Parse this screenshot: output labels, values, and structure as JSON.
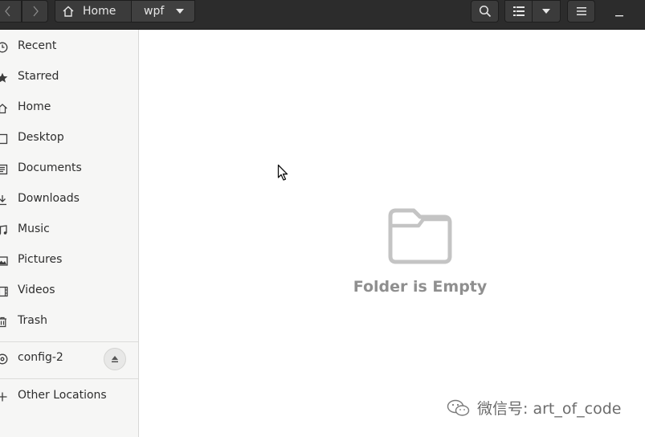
{
  "header": {
    "path": [
      {
        "label": "Home",
        "icon": "home-icon"
      },
      {
        "label": "wpf",
        "icon": "chevron-down-icon"
      }
    ]
  },
  "sidebar": {
    "places": [
      {
        "label": "Recent",
        "icon": "clock-icon"
      },
      {
        "label": "Starred",
        "icon": "star-icon"
      },
      {
        "label": "Home",
        "icon": "home-icon"
      },
      {
        "label": "Desktop",
        "icon": "desktop-icon"
      },
      {
        "label": "Documents",
        "icon": "document-icon"
      },
      {
        "label": "Downloads",
        "icon": "download-icon"
      },
      {
        "label": "Music",
        "icon": "music-icon"
      },
      {
        "label": "Pictures",
        "icon": "picture-icon"
      },
      {
        "label": "Videos",
        "icon": "video-icon"
      },
      {
        "label": "Trash",
        "icon": "trash-icon"
      }
    ],
    "devices": [
      {
        "label": "config-2",
        "icon": "disc-icon"
      }
    ],
    "other": {
      "label": "Other Locations",
      "icon": "plus-icon"
    }
  },
  "main": {
    "empty_message": "Folder is Empty"
  },
  "watermark": {
    "text": "微信号: art_of_code"
  },
  "colors": {
    "headerbar": "#2c2c2c",
    "sidebar": "#f6f6f5",
    "empty_text": "#8f8f8f"
  }
}
